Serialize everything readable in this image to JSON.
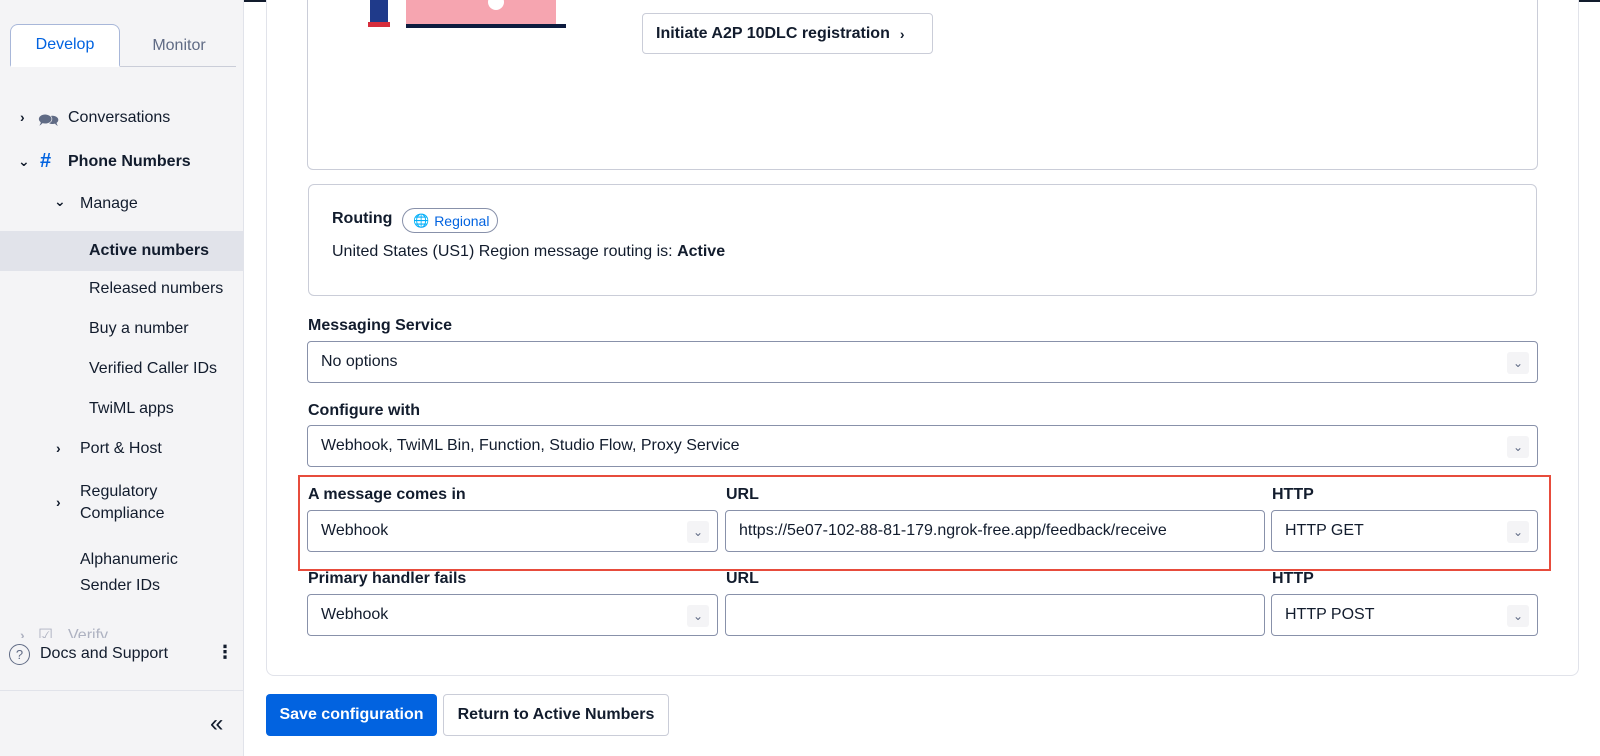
{
  "sidebar": {
    "tabs": [
      {
        "label": "Develop",
        "active": true
      },
      {
        "label": "Monitor",
        "active": false
      }
    ],
    "items": {
      "conversations": "Conversations",
      "phone_numbers": "Phone Numbers",
      "manage": "Manage",
      "active_numbers": "Active numbers",
      "released_numbers": "Released numbers",
      "buy_number": "Buy a number",
      "verified_caller_ids": "Verified Caller IDs",
      "twiml_apps": "TwiML apps",
      "port_host": "Port & Host",
      "regulatory_line1": "Regulatory",
      "regulatory_line2": "Compliance",
      "alphanumeric_line1": "Alphanumeric",
      "alphanumeric_line2": "Sender IDs",
      "verify": "Verify"
    },
    "docs_label": "Docs and Support",
    "icons": {
      "conversations": "chat-bubbles-icon",
      "phone_numbers": "hash-icon",
      "help": "help-circle-icon",
      "more": "kebab-icon",
      "collapse": "double-chevron-left-icon"
    }
  },
  "main": {
    "a2p_button": "Initiate A2P 10DLC registration",
    "routing": {
      "label": "Routing",
      "badge": "Regional",
      "text_prefix": "United States (US1) Region message routing is:",
      "status": "Active"
    },
    "messaging_service": {
      "label": "Messaging Service",
      "value": "No options"
    },
    "configure_with": {
      "label": "Configure with",
      "value": "Webhook, TwiML Bin, Function, Studio Flow, Proxy Service"
    },
    "message_comes_in": {
      "label": "A message comes in",
      "handler": "Webhook",
      "url_label": "URL",
      "url": "https://5e07-102-88-81-179.ngrok-free.app/feedback/receive",
      "http_label": "HTTP",
      "http": "HTTP GET"
    },
    "primary_handler_fails": {
      "label": "Primary handler fails",
      "handler": "Webhook",
      "url_label": "URL",
      "url": "",
      "http_label": "HTTP",
      "http": "HTTP POST"
    },
    "save_button": "Save configuration",
    "return_button": "Return to Active Numbers"
  },
  "colors": {
    "accent": "#0263e0",
    "highlight": "#e74c3c",
    "sidebar_bg": "#f4f4f6"
  }
}
